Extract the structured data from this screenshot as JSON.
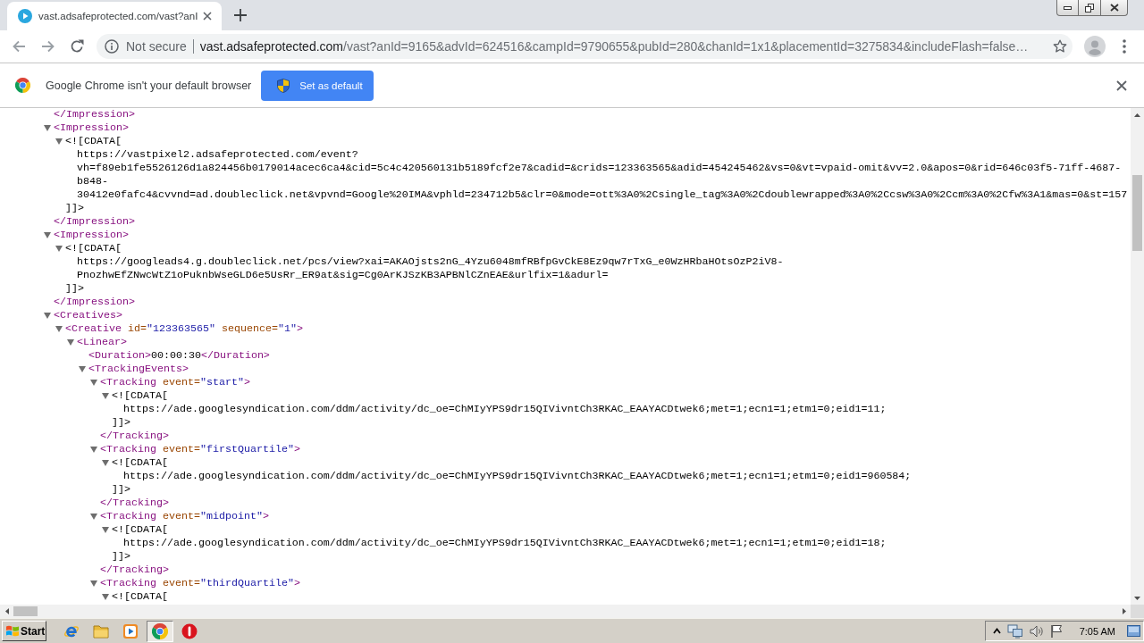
{
  "tabs": [
    {
      "title": "vast.adsafeprotected.com/vast?anI",
      "selected": true
    }
  ],
  "address_bar": {
    "security_label": "Not secure",
    "host": "vast.adsafeprotected.com",
    "path": "/vast?anId=9165&advId=624516&campId=9790655&pubId=280&chanId=1x1&placementId=3275834&includeFlash=false…"
  },
  "infobar": {
    "message": "Google Chrome isn't your default browser",
    "button": "Set as default"
  },
  "xml_tree": [
    {
      "kind": "close",
      "close": "</Impression>"
    },
    {
      "kind": "element",
      "open": "<Impression>",
      "expanded": true,
      "children": [
        {
          "kind": "cdata",
          "open": "<![CDATA[",
          "expanded": true,
          "lines": [
            "https://vastpixel2.adsafeprotected.com/event?",
            "vh=f89eb1fe5526126d1a824456b0179014acec6ca4&cid=5c4c420560131b5189fcf2e7&cadid=&crids=123363565&adid=454245462&vs=0&vt=vpaid-omit&vv=2.0&apos=0&rid=646c03f5-71ff-4687-",
            "b848-",
            "30412e0fafc4&cvvnd=ad.doubleclick.net&vpvnd=Google%20IMA&vphld=234712b5&clr=0&mode=ott%3A0%2Csingle_tag%3A0%2Cdoublewrapped%3A0%2Ccsw%3A0%2Ccm%3A0%2Cfw%3A1&mas=0&st=157"
          ],
          "close": "]]>"
        }
      ],
      "close": "</Impression>"
    },
    {
      "kind": "element",
      "open": "<Impression>",
      "expanded": true,
      "children": [
        {
          "kind": "cdata",
          "open": "<![CDATA[",
          "expanded": true,
          "lines": [
            "https://googleads4.g.doubleclick.net/pcs/view?xai=AKAOjsts2nG_4Yzu6048mfRBfpGvCkE8Ez9qw7rTxG_e0WzHRbaHOtsOzP2iV8-",
            "PnozhwEfZNwcWtZ1oPuknbWseGLD6e5UsRr_ER9at&sig=Cg0ArKJSzKB3APBNlCZnEAE&urlfix=1&adurl="
          ],
          "close": "]]>"
        }
      ],
      "close": "</Impression>"
    },
    {
      "kind": "element",
      "open": "<Creatives>",
      "expanded": true,
      "children": [
        {
          "kind": "element",
          "open": "<Creative id=\"123363565\" sequence=\"1\">",
          "expanded": true,
          "children": [
            {
              "kind": "element",
              "open": "<Linear>",
              "expanded": true,
              "children": [
                {
                  "kind": "leaf",
                  "open": "<Duration>",
                  "text": "00:00:30",
                  "close": "</Duration>"
                },
                {
                  "kind": "element",
                  "open": "<TrackingEvents>",
                  "expanded": true,
                  "children": [
                    {
                      "kind": "element",
                      "open": "<Tracking event=\"start\">",
                      "expanded": true,
                      "children": [
                        {
                          "kind": "cdata",
                          "open": "<![CDATA[",
                          "expanded": true,
                          "lines": [
                            "https://ade.googlesyndication.com/ddm/activity/dc_oe=ChMIyYPS9dr15QIVivntCh3RKAC_EAAYACDtwek6;met=1;ecn1=1;etm1=0;eid1=11;"
                          ],
                          "close": "]]>"
                        }
                      ],
                      "close": "</Tracking>"
                    },
                    {
                      "kind": "element",
                      "open": "<Tracking event=\"firstQuartile\">",
                      "expanded": true,
                      "children": [
                        {
                          "kind": "cdata",
                          "open": "<![CDATA[",
                          "expanded": true,
                          "lines": [
                            "https://ade.googlesyndication.com/ddm/activity/dc_oe=ChMIyYPS9dr15QIVivntCh3RKAC_EAAYACDtwek6;met=1;ecn1=1;etm1=0;eid1=960584;"
                          ],
                          "close": "]]>"
                        }
                      ],
                      "close": "</Tracking>"
                    },
                    {
                      "kind": "element",
                      "open": "<Tracking event=\"midpoint\">",
                      "expanded": true,
                      "children": [
                        {
                          "kind": "cdata",
                          "open": "<![CDATA[",
                          "expanded": true,
                          "lines": [
                            "https://ade.googlesyndication.com/ddm/activity/dc_oe=ChMIyYPS9dr15QIVivntCh3RKAC_EAAYACDtwek6;met=1;ecn1=1;etm1=0;eid1=18;"
                          ],
                          "close": "]]>"
                        }
                      ],
                      "close": "</Tracking>"
                    },
                    {
                      "kind": "element",
                      "open": "<Tracking event=\"thirdQuartile\">",
                      "expanded": true,
                      "children": [
                        {
                          "kind": "cdata",
                          "open": "<![CDATA[",
                          "expanded": true
                        }
                      ]
                    }
                  ]
                }
              ]
            }
          ]
        }
      ]
    }
  ],
  "taskbar": {
    "start": "Start",
    "apps": [
      {
        "kind": "ie",
        "selected": false
      },
      {
        "kind": "folder",
        "selected": false
      },
      {
        "kind": "media",
        "selected": false
      },
      {
        "kind": "chrome",
        "selected": true
      },
      {
        "kind": "alert",
        "selected": false
      }
    ],
    "clock": "7:05 AM"
  }
}
